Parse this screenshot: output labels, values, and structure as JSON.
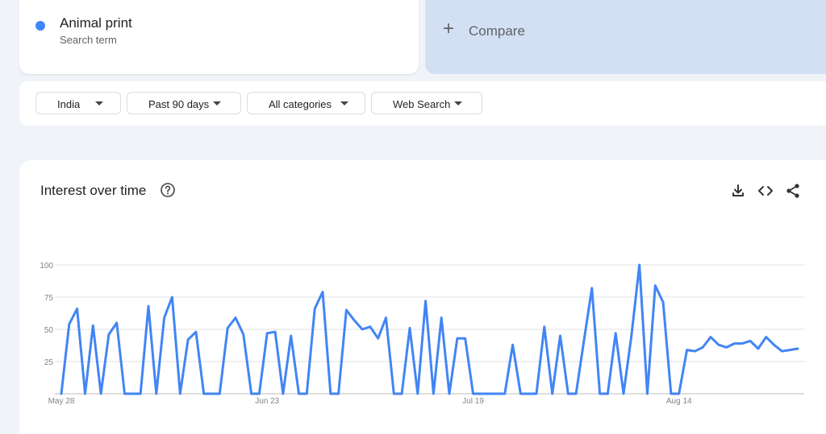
{
  "term": {
    "name": "Animal print",
    "subtitle": "Search term",
    "color": "#4285f4"
  },
  "compare": {
    "label": "Compare",
    "icon": "plus-icon"
  },
  "filters": [
    {
      "label": "India"
    },
    {
      "label": "Past 90 days"
    },
    {
      "label": "All categories"
    },
    {
      "label": "Web Search"
    }
  ],
  "chart": {
    "title": "Interest over time",
    "icons": {
      "help": "help-icon",
      "download": "download-icon",
      "embed": "embed-code-icon",
      "share": "share-icon"
    }
  },
  "chart_data": {
    "type": "line",
    "series": [
      {
        "color": "#4285f4",
        "values": [
          0,
          54,
          66,
          0,
          53,
          0,
          46,
          55,
          0,
          0,
          0,
          68,
          0,
          59,
          75,
          0,
          42,
          48,
          0,
          0,
          0,
          51,
          59,
          46,
          0,
          0,
          47,
          48,
          0,
          45,
          0,
          0,
          66,
          79,
          0,
          0,
          65,
          57,
          50,
          52,
          43,
          59,
          0,
          0,
          51,
          0,
          72,
          0,
          59,
          0,
          43,
          43,
          0,
          0,
          0,
          0,
          0,
          38,
          0,
          0,
          0,
          52,
          0,
          45,
          0,
          0,
          41,
          82,
          0,
          0,
          47,
          0,
          45,
          100,
          0,
          84,
          71,
          0,
          0,
          34,
          33,
          36,
          44,
          38,
          36,
          39,
          39,
          41,
          35,
          44,
          38,
          33,
          34,
          35
        ]
      }
    ],
    "x_tick_labels": [
      "May 28",
      "Jun 23",
      "Jul 19",
      "Aug 14"
    ],
    "x_tick_indices": [
      0,
      26,
      52,
      78
    ],
    "y_tick_labels": [
      "100",
      "75",
      "50",
      "25"
    ],
    "y_tick_values": [
      100,
      75,
      50,
      25
    ],
    "ylim": [
      0,
      100
    ],
    "grid": true,
    "colors": {
      "line": "#4285f4",
      "grid": "#e0e0e0",
      "axis": "#bdbdbd",
      "tick_text": "#80868b"
    }
  }
}
